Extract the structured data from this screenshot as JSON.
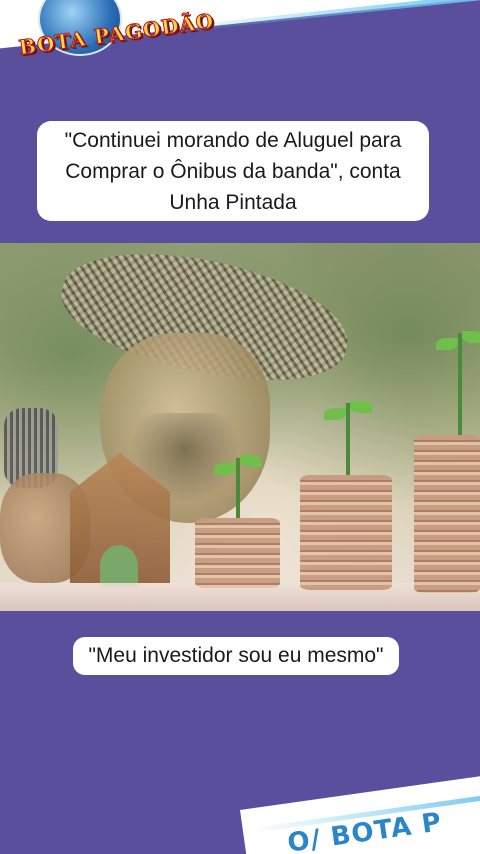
{
  "header": {
    "logo_text": "BOTA PAGODÃO"
  },
  "headline": {
    "text": "\"Continuei morando de Aluguel para Comprar o Ônibus da banda\", conta Unha Pintada"
  },
  "caption": {
    "text": "\"Meu investidor sou eu mesmo\""
  },
  "footer": {
    "watermark_text": "O/ BOTA P"
  },
  "colors": {
    "background": "#5a4f9c",
    "box": "#ffffff",
    "accent_blue": "#6ec6ee"
  }
}
